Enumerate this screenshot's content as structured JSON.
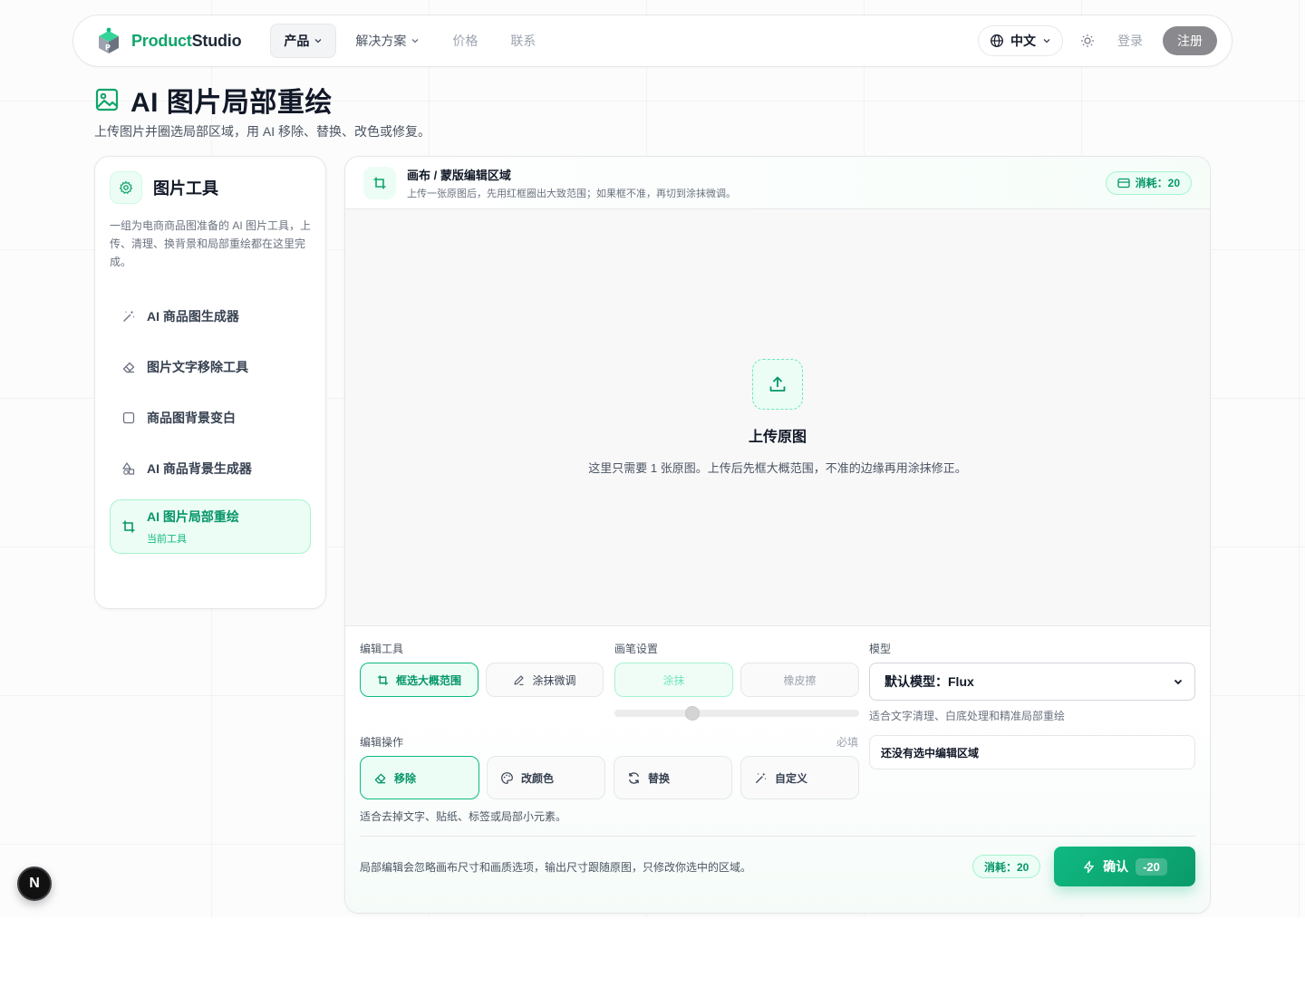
{
  "nav": {
    "brand_a": "Product",
    "brand_b": "Studio",
    "items": [
      {
        "label": "产品",
        "dropdown": true,
        "active": true
      },
      {
        "label": "解决方案",
        "dropdown": true
      },
      {
        "label": "价格"
      },
      {
        "label": "联系"
      }
    ],
    "language": "中文",
    "login": "登录",
    "signup": "注册"
  },
  "page": {
    "title": "AI 图片局部重绘",
    "subtitle": "上传图片并圈选局部区域，用 AI 移除、替换、改色或修复。"
  },
  "sidebar": {
    "title": "图片工具",
    "description": "一组为电商商品图准备的 AI 图片工具，上传、清理、换背景和局部重绘都在这里完成。",
    "items": [
      {
        "label": "AI 商品图生成器",
        "icon": "magic-wand-icon"
      },
      {
        "label": "图片文字移除工具",
        "icon": "eraser-icon"
      },
      {
        "label": "商品图背景变白",
        "icon": "square-icon"
      },
      {
        "label": "AI 商品背景生成器",
        "icon": "shapes-icon"
      },
      {
        "label": "AI 图片局部重绘",
        "icon": "crop-icon",
        "active": true,
        "current_label": "当前工具"
      }
    ]
  },
  "main": {
    "header_title": "画布 / 蒙版编辑区域",
    "header_sub": "上传一张原图后，先用红框圈出大致范围；如果框不准，再切到涂抹微调。",
    "cost_label": "消耗：20",
    "upload_title": "上传原图",
    "upload_desc": "这里只需要 1 张原图。上传后先框大概范围，不准的边缘再用涂抹修正。"
  },
  "controls": {
    "edit_tools_label": "编辑工具",
    "tool_box": "框选大概范围",
    "tool_brush": "涂抹微调",
    "brush_settings_label": "画笔设置",
    "brush_paint": "涂抹",
    "brush_erase": "橡皮擦",
    "brush_size": 0.32,
    "model_label": "模型",
    "model_value": "默认模型：Flux",
    "model_hint": "适合文字清理、白底处理和精准局部重绘",
    "edit_ops_label": "编辑操作",
    "required": "必填",
    "ops": [
      "移除",
      "改颜色",
      "替换",
      "自定义"
    ],
    "op_hint": "适合去掉文字、贴纸、标签或局部小元素。",
    "selection_status": "还没有选中编辑区域",
    "footer_note": "局部编辑会忽略画布尺寸和画质选项，输出尺寸跟随原图，只修改你选中的区域。",
    "cost_label": "消耗：20",
    "confirm": "确认",
    "confirm_cost": "-20"
  },
  "badge": "N",
  "colors": {
    "accent": "#10b981",
    "accent_dark": "#059669",
    "accent_bg": "#ecfdf5"
  }
}
